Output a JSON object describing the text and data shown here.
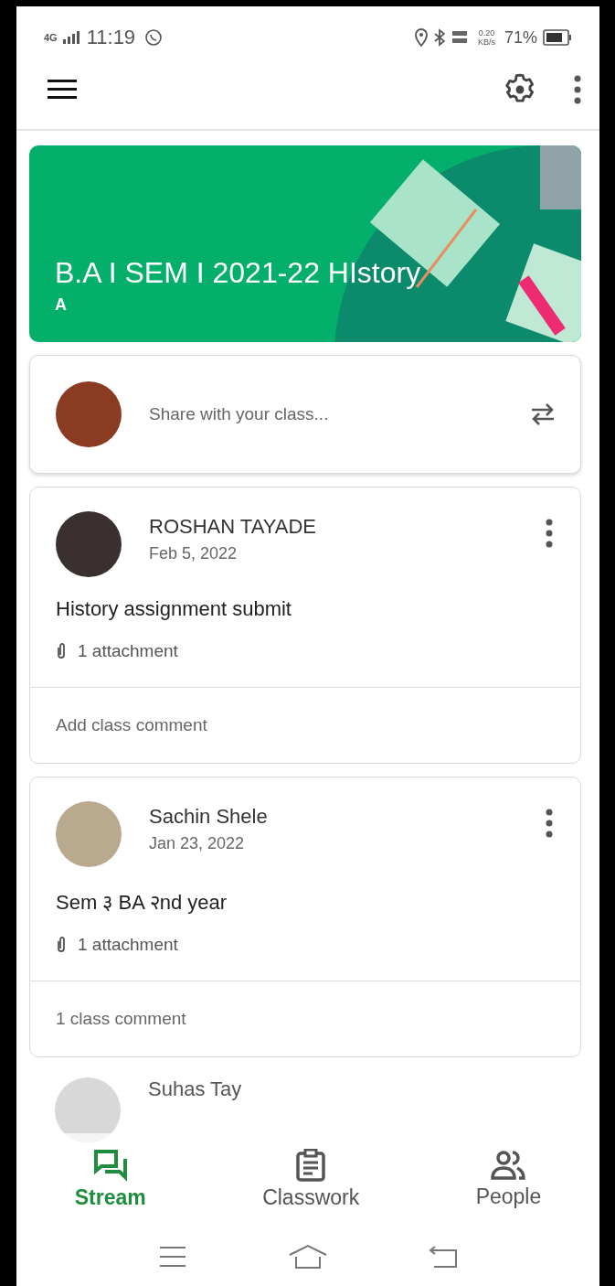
{
  "status_bar": {
    "network": "4G",
    "time": "11:19",
    "speed": "0.20",
    "speed_unit": "KB/s",
    "battery": "71%"
  },
  "class_banner": {
    "title": "B.A I SEM I 2021-22 HIstory",
    "section": "A"
  },
  "share": {
    "placeholder": "Share with your class..."
  },
  "posts": [
    {
      "author": "ROSHAN TAYADE",
      "date": "Feb 5, 2022",
      "text": "History assignment submit",
      "attachments": "1 attachment",
      "comment": "Add class comment"
    },
    {
      "author": "Sachin Shele",
      "date": "Jan 23, 2022",
      "text": "Sem ३ BA २nd year",
      "attachments": "1 attachment",
      "comment": "1 class comment"
    }
  ],
  "hidden_post": {
    "author": "Suhas Tay"
  },
  "bottom_nav": [
    {
      "label": "Stream",
      "kind": "stream",
      "selected": true
    },
    {
      "label": "Classwork",
      "kind": "classwork",
      "selected": false
    },
    {
      "label": "People",
      "kind": "people",
      "selected": false
    }
  ]
}
